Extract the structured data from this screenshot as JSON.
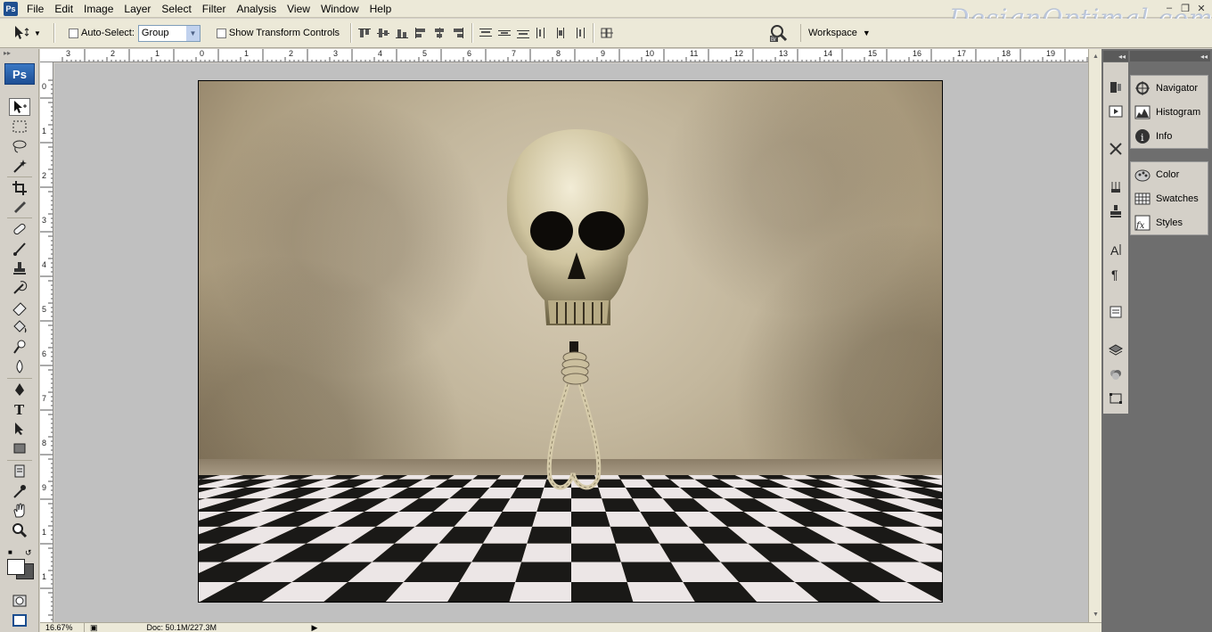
{
  "menubar": {
    "app_badge": "Ps",
    "items": [
      "File",
      "Edit",
      "Image",
      "Layer",
      "Select",
      "Filter",
      "Analysis",
      "View",
      "Window",
      "Help"
    ],
    "watermark": "DesignOptimal.com"
  },
  "options": {
    "auto_select_label": "Auto-Select:",
    "auto_select_value": "Group",
    "show_transform_label": "Show Transform Controls",
    "workspace_label": "Workspace"
  },
  "toolbox": {
    "logo": "Ps"
  },
  "rulers": {
    "top": [
      "3",
      "2",
      "1",
      "0",
      "1",
      "2",
      "3",
      "4",
      "5",
      "6",
      "7",
      "8",
      "9",
      "10",
      "11",
      "12",
      "13",
      "14",
      "15",
      "16",
      "17",
      "18",
      "19"
    ],
    "left": [
      "0",
      "1",
      "2",
      "3",
      "4",
      "5",
      "6",
      "7",
      "8",
      "9",
      "1",
      "1"
    ]
  },
  "statusbar": {
    "zoom": "16.67%",
    "doc": "Doc: 50.1M/227.3M"
  },
  "panels": {
    "group1": [
      {
        "label": "Navigator",
        "icon": "navigator-icon"
      },
      {
        "label": "Histogram",
        "icon": "histogram-icon"
      },
      {
        "label": "Info",
        "icon": "info-icon"
      }
    ],
    "group2": [
      {
        "label": "Color",
        "icon": "color-icon"
      },
      {
        "label": "Swatches",
        "icon": "swatches-icon"
      },
      {
        "label": "Styles",
        "icon": "styles-icon"
      }
    ]
  }
}
